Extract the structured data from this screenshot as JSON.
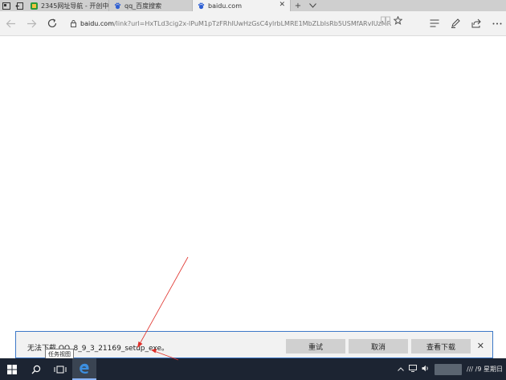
{
  "tabs": [
    {
      "label": "2345网址导航 - 开创中国百",
      "active": false
    },
    {
      "label": "qq_百度搜索",
      "active": false
    },
    {
      "label": "baidu.com",
      "active": true
    }
  ],
  "address": {
    "domain": "baidu.com",
    "path": "/link?url=HxTLd3cig2x-lPuM1pTzFRhlUwHzGsC4ylrbLMRE1MbZLbIsRb5USMfARvIUzMR"
  },
  "download": {
    "message": "无法下载 QQ_8_9_3_21169_setup_exe。",
    "retry_label": "重试",
    "cancel_label": "取消",
    "view_label": "查看下载"
  },
  "tooltip": "任务视图",
  "tray": {
    "clock": "/// /9 星期日"
  },
  "colors": {
    "accent": "#3c78c8",
    "taskbar": "#1c2432",
    "arrow": "#e0302a"
  },
  "icons": [
    "tab-preview-icon",
    "tab-back-icon",
    "baidu-paw-icon",
    "close-icon",
    "new-tab-icon",
    "chevron-down-icon",
    "back-arrow-icon",
    "forward-arrow-icon",
    "refresh-icon",
    "lock-icon",
    "reading-view-icon",
    "favorite-star-icon",
    "hub-icon",
    "pen-icon",
    "share-icon",
    "more-icon",
    "windows-logo-icon",
    "search-icon",
    "task-view-icon",
    "edge-icon"
  ]
}
